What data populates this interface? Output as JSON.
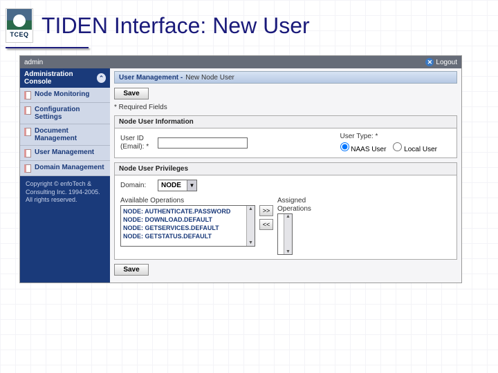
{
  "slide": {
    "title": "TIDEN Interface: New User",
    "logo_label": "TCEQ"
  },
  "topbar": {
    "user": "admin",
    "logout": "Logout"
  },
  "sidebar": {
    "header": "Administration Console",
    "items": [
      {
        "label": "Node Monitoring"
      },
      {
        "label": "Configuration Settings"
      },
      {
        "label": "Document Management"
      },
      {
        "label": "User Management"
      },
      {
        "label": "Domain Management"
      }
    ],
    "footer": "Copyright © enfoTech & Consulting Inc. 1994-2005. All rights reserved."
  },
  "content": {
    "banner_main": "User Management -",
    "banner_sub": "New Node User",
    "save_label": "Save",
    "required_note": "* Required Fields",
    "user_info": {
      "header": "Node User Information",
      "user_id_label": "User ID (Email): *",
      "user_id_value": "",
      "user_type_label": "User Type: *",
      "radios": {
        "naas": "NAAS User",
        "local": "Local User",
        "selected": "naas"
      }
    },
    "privileges": {
      "header": "Node User Privileges",
      "domain_label": "Domain:",
      "domain_value": "NODE",
      "available_label": "Available Operations",
      "assigned_label": "Assigned Operations",
      "available": [
        "NODE: AUTHENTICATE.PASSWORD",
        "NODE: DOWNLOAD.DEFAULT",
        "NODE: GETSERVICES.DEFAULT",
        "NODE: GETSTATUS.DEFAULT"
      ],
      "move_right": ">>",
      "move_left": "<<"
    }
  }
}
